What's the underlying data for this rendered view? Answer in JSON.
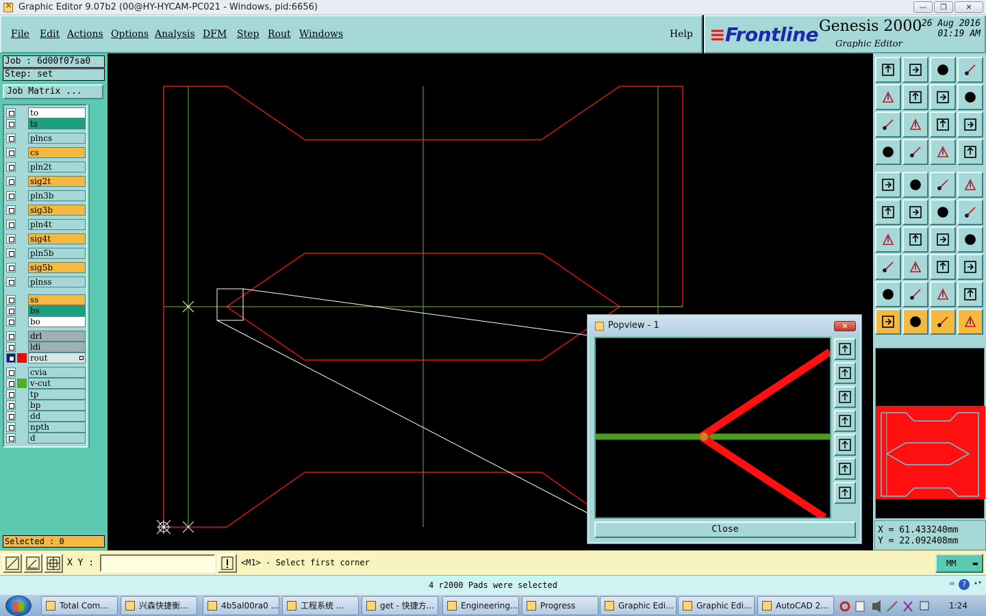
{
  "window": {
    "title": "Graphic Editor 9.07b2 (00@HY-HYCAM-PC021 - Windows, pid:6656)",
    "controls": [
      "—",
      "❐",
      "✕"
    ]
  },
  "menu": {
    "file": "File",
    "edit": "Edit",
    "actions": "Actions",
    "options": "Options",
    "analysis": "Analysis",
    "dfm": "DFM",
    "step": "Step",
    "rout": "Rout",
    "windows": "Windows",
    "help": "Help"
  },
  "brand": {
    "logo": "Frontline",
    "product": "Genesis 2000",
    "subtitle": "Graphic Editor",
    "date": "26 Aug 2016",
    "time": "01:19 AM"
  },
  "left": {
    "job": "Job  :  6d00f07sa0",
    "step": "Step:  set",
    "job_matrix": "Job Matrix ...",
    "selected": "Selected : 0",
    "layers": [
      {
        "name": "to",
        "color": "#ffffff",
        "group": 0
      },
      {
        "name": "ts",
        "color": "#1aa07c",
        "group": 0
      },
      {
        "name": "plncs",
        "color": "#a7d8d8",
        "group": 1
      },
      {
        "name": "cs",
        "color": "#f5b841",
        "group": 1
      },
      {
        "name": "pln2t",
        "color": "#a7d8d8",
        "group": 1
      },
      {
        "name": "sig2t",
        "color": "#f5b841",
        "group": 1
      },
      {
        "name": "pln3b",
        "color": "#a7d8d8",
        "group": 1
      },
      {
        "name": "sig3b",
        "color": "#f5b841",
        "group": 1
      },
      {
        "name": "pln4t",
        "color": "#a7d8d8",
        "group": 1
      },
      {
        "name": "sig4t",
        "color": "#f5b841",
        "group": 1
      },
      {
        "name": "pln5b",
        "color": "#a7d8d8",
        "group": 1
      },
      {
        "name": "sig5b",
        "color": "#f5b841",
        "group": 1
      },
      {
        "name": "plnss",
        "color": "#a7d8d8",
        "group": 1
      },
      {
        "name": "ss",
        "color": "#f5b841",
        "group": 2
      },
      {
        "name": "bs",
        "color": "#1aa07c",
        "group": 2
      },
      {
        "name": "bo",
        "color": "#ffffff",
        "group": 2
      },
      {
        "name": "drl",
        "color": "#9fb0b4",
        "group": 3
      },
      {
        "name": "ldi",
        "color": "#9fb0b4",
        "group": 3
      },
      {
        "name": "rout",
        "color": "#d9e6e6",
        "group": 3,
        "active": true
      },
      {
        "name": "cvia",
        "color": "#a7d8d8",
        "group": 4
      },
      {
        "name": "v-cut",
        "color": "#a7d8d8",
        "group": 4,
        "swatch": "#4caf2a"
      },
      {
        "name": "tp",
        "color": "#a7d8d8",
        "group": 4
      },
      {
        "name": "bp",
        "color": "#a7d8d8",
        "group": 4
      },
      {
        "name": "dd",
        "color": "#a7d8d8",
        "group": 4
      },
      {
        "name": "npth",
        "color": "#a7d8d8",
        "group": 4
      },
      {
        "name": "d",
        "color": "#a7d8d8",
        "group": 4
      }
    ]
  },
  "colors": {
    "profile": "#e01010",
    "vcut": "#4f9a20",
    "zoom": "#ffffff",
    "panel": "#a7d8d8",
    "accent": "#f5b841"
  },
  "popview": {
    "title": "Popview - 1",
    "close_label": "Close"
  },
  "coords": {
    "x": "X  =  61.433240mm",
    "y": "Y  =  22.092408mm"
  },
  "command": {
    "xy_label": "X Y :",
    "xy_value": "",
    "prompt": "<M1> - Select first corner",
    "unit": "MM"
  },
  "status": {
    "message": "4 r2000 Pads were selected"
  },
  "taskbar": {
    "items": [
      "Total Com...",
      "兴森快捷衡...",
      "4b5al00ra0 ...",
      "工程系统   ...",
      "get - 快捷方...",
      "Engineering...",
      "Progress",
      "Graphic Edi...",
      "Graphic Edi...",
      "AutoCAD 2..."
    ],
    "clock": "1:24"
  }
}
